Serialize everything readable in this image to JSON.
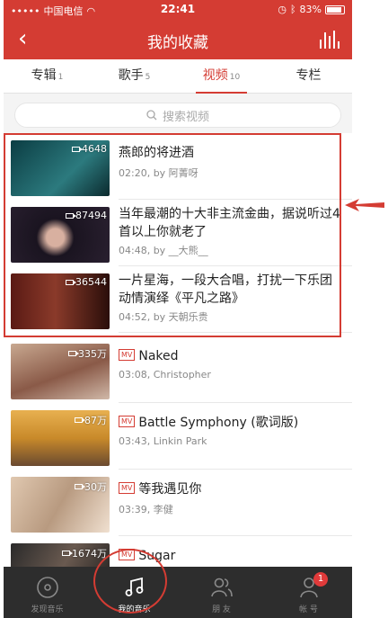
{
  "status": {
    "carrier": "中国电信",
    "time": "22:41",
    "battery": "83%"
  },
  "header": {
    "title": "我的收藏"
  },
  "tabs": [
    {
      "label": "专辑",
      "count": "1"
    },
    {
      "label": "歌手",
      "count": "5"
    },
    {
      "label": "视频",
      "count": "10"
    },
    {
      "label": "专栏",
      "count": ""
    }
  ],
  "search": {
    "placeholder": "搜索视频"
  },
  "videos": [
    {
      "plays": "4648",
      "title": "燕郎的将进酒",
      "meta": "02:20, by  阿菁呀",
      "mv": "",
      "thumb": [
        "#0b3d43",
        "#15575c"
      ]
    },
    {
      "plays": "87494",
      "title": "当年最潮的十大非主流金曲，据说听过4首以上你就老了",
      "meta": "04:48, by  __大熊__",
      "mv": "",
      "thumb": [
        "#14141a",
        "#3a2a3a"
      ]
    },
    {
      "plays": "36544",
      "title": "一片星海，一段大合唱，打扰一下乐团动情演绎《平凡之路》",
      "meta": "04:52, by  天朝乐贵",
      "mv": "",
      "thumb": [
        "#3a1410",
        "#6a2a1e"
      ]
    },
    {
      "plays": "335万",
      "title": "Naked",
      "meta": "03:08, Christopher",
      "mv": "MV",
      "thumb": [
        "#a8705a",
        "#d8b8a0"
      ]
    },
    {
      "plays": "87万",
      "title": "Battle Symphony (歌词版)",
      "meta": "03:43, Linkin Park",
      "mv": "MV",
      "thumb": [
        "#c98a2a",
        "#e8c070"
      ]
    },
    {
      "plays": "30万",
      "title": "等我遇见你",
      "meta": "03:39, 李健",
      "mv": "MV",
      "thumb": [
        "#b89a80",
        "#e0c8b0"
      ]
    },
    {
      "plays": "1674万",
      "title": "Sugar",
      "meta": "",
      "mv": "MV",
      "thumb": [
        "#1a1a1a",
        "#5a4a40"
      ]
    }
  ],
  "bottom_nav": [
    {
      "label": "发现音乐",
      "icon": "disc-icon"
    },
    {
      "label": "我的音乐",
      "icon": "music-note-icon"
    },
    {
      "label": "朋 友",
      "icon": "friends-icon"
    },
    {
      "label": "帐 号",
      "icon": "account-icon",
      "badge": "1"
    }
  ],
  "colors": {
    "brand": "#d43c33",
    "bottom_bar": "#2d2d2d"
  }
}
